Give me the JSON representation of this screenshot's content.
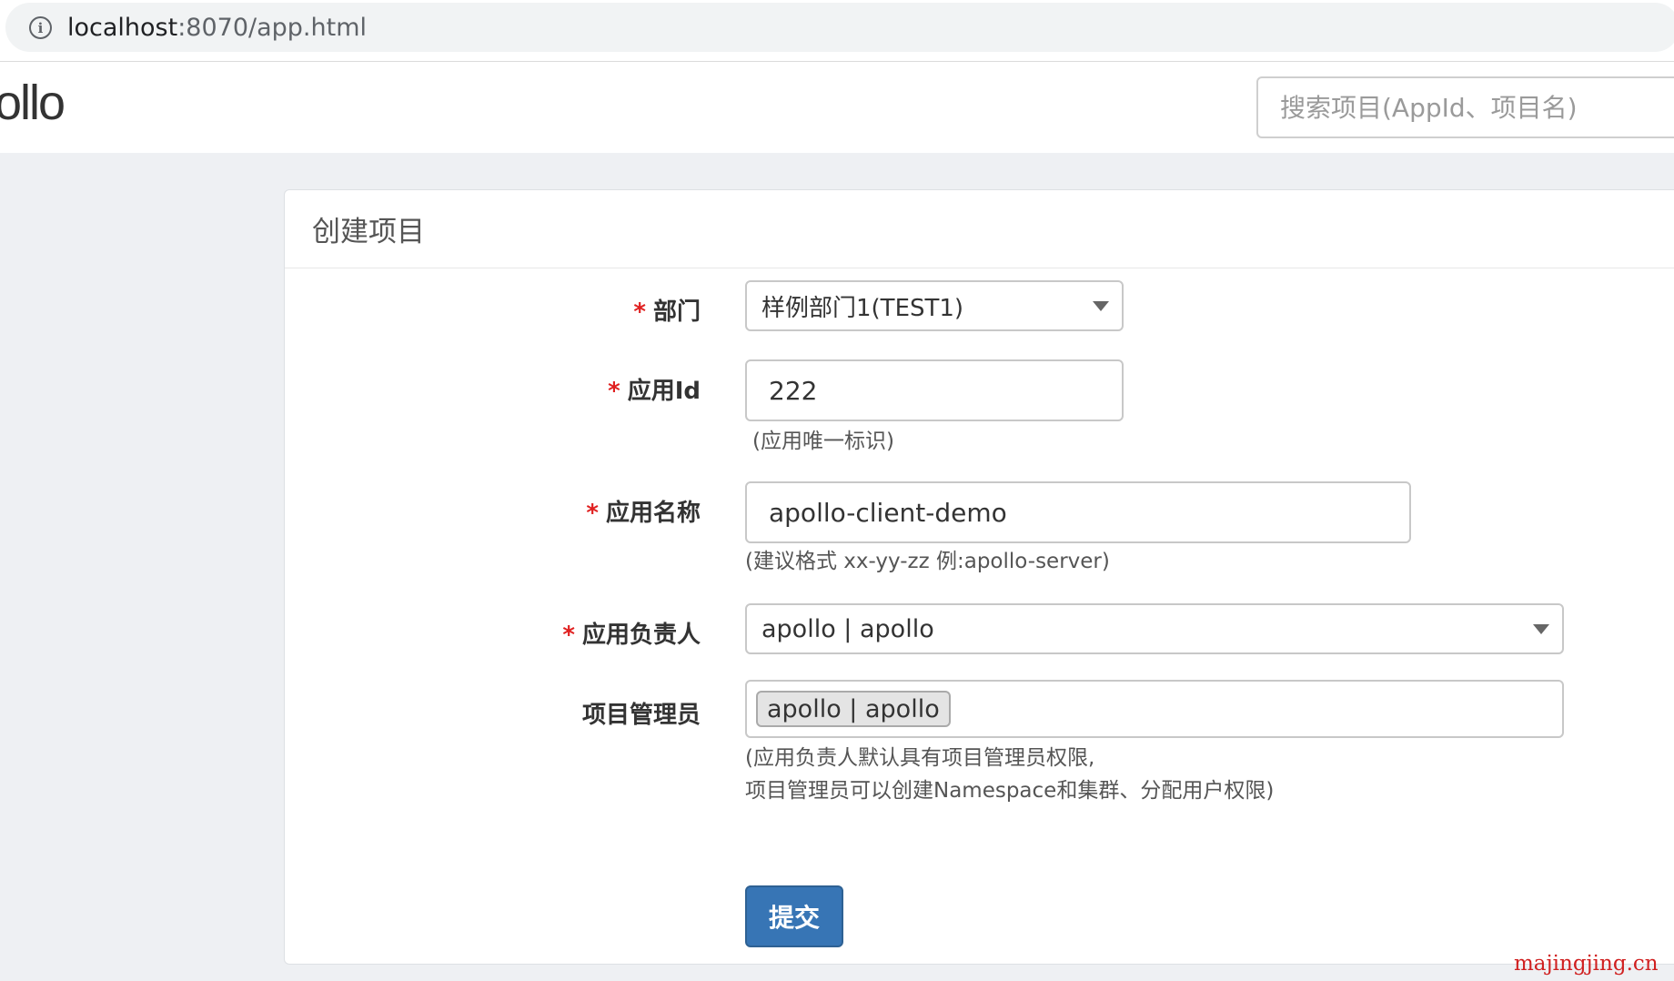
{
  "browser": {
    "url_host": "localhost",
    "url_rest": ":8070/app.html",
    "info_icon": "info-icon"
  },
  "header": {
    "logo_text": "ollo",
    "search_placeholder": "搜索项目(AppId、项目名)"
  },
  "panel": {
    "title": "创建项目"
  },
  "form": {
    "required_mark": "*",
    "department": {
      "label": "部门",
      "value": "样例部门1(TEST1)"
    },
    "app_id": {
      "label": "应用Id",
      "value": "222",
      "help": "(应用唯一标识)"
    },
    "app_name": {
      "label": "应用名称",
      "value": "apollo-client-demo",
      "help": "(建议格式 xx-yy-zz 例:apollo-server)"
    },
    "owner": {
      "label": "应用负责人",
      "value": "apollo | apollo"
    },
    "admins": {
      "label": "项目管理员",
      "tag": "apollo | apollo",
      "help_line1": "(应用负责人默认具有项目管理员权限,",
      "help_line2": "项目管理员可以创建Namespace和集群、分配用户权限)"
    },
    "submit_label": "提交"
  },
  "watermark": "majingjing.cn",
  "colors": {
    "primary": "#3775b5",
    "required": "#e02020",
    "page_bg": "#eef0f3"
  }
}
